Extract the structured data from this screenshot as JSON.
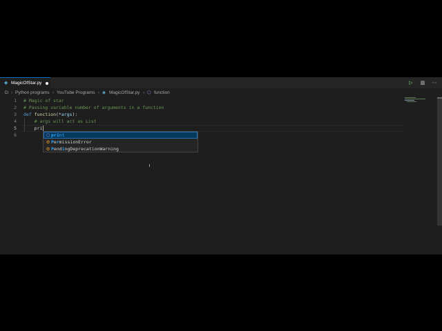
{
  "tab": {
    "icon": "python-file-icon",
    "label": "MagicOfStar.py"
  },
  "actions": {
    "run_icon": "run-icon",
    "split_icon": "split-editor-icon",
    "more_icon": "more-icon"
  },
  "breadcrumbs": {
    "drive": "D:",
    "folder1": "Python programs",
    "folder2": "YouTube Programs",
    "file": "MagicOfStar.py",
    "symbol": "function"
  },
  "gutter": [
    "1",
    "2",
    "3",
    "4",
    "5",
    "6"
  ],
  "code": {
    "line1": "# Magic of star",
    "line2": "# Passing variable number of arguments in a function",
    "line3_kw": "def",
    "line3_fn": "function",
    "line3_open": "(*",
    "line3_param": "args",
    "line3_close": "):",
    "line4": "    # args will act as List",
    "line5": "    pri"
  },
  "suggestions": [
    {
      "kind": "method-icon",
      "match": "pri",
      "rest": "nt"
    },
    {
      "kind": "class-icon",
      "pre": "",
      "m1": "P",
      "mid": "e",
      "m2": "r",
      "post": "missionError"
    },
    {
      "kind": "class-icon",
      "pre": "",
      "m1": "P",
      "mid": "end",
      "m2": "i",
      "post": "ngDeprecationWarning"
    }
  ],
  "colors": {
    "accent": "#0e70c0",
    "editor_bg": "#1e1e1e",
    "selection": "#04395e"
  }
}
